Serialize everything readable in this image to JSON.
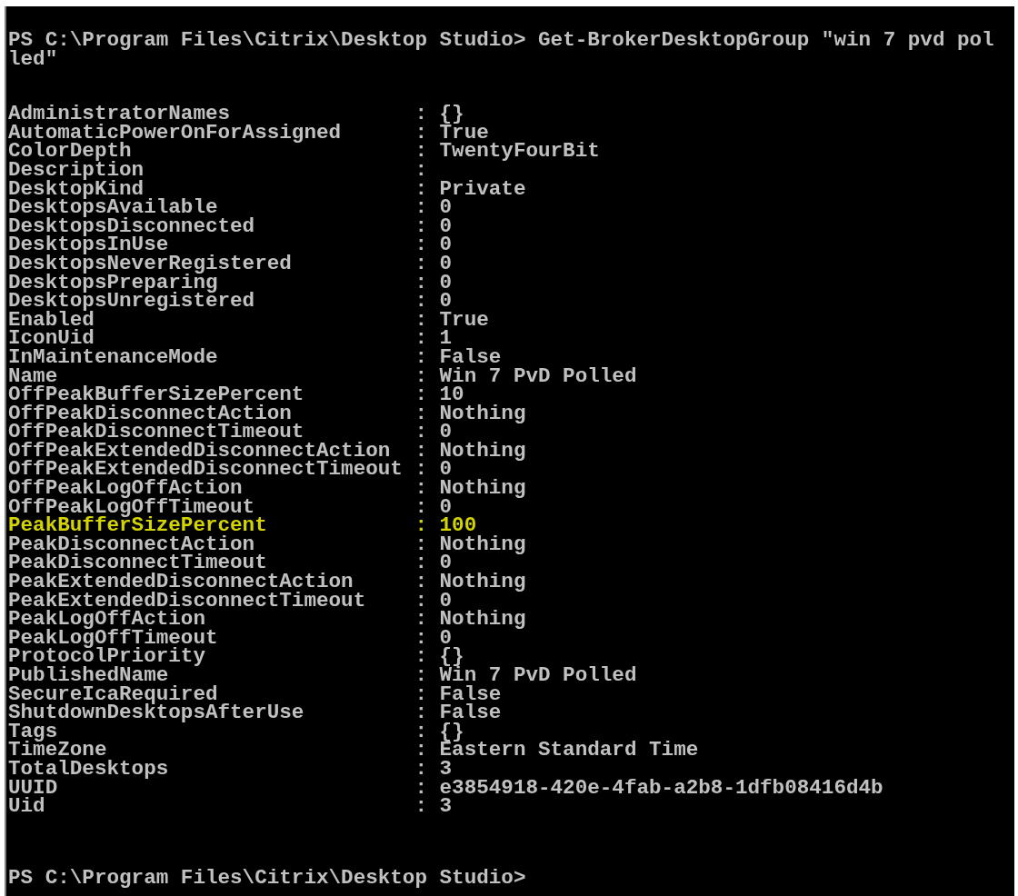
{
  "command_lines": [
    "PS C:\\Program Files\\Citrix\\Desktop Studio> Get-BrokerDesktopGroup \"win 7 pvd pol",
    "led\""
  ],
  "properties": [
    {
      "name": "AdministratorNames",
      "value": ": {}",
      "highlighted": false
    },
    {
      "name": "AutomaticPowerOnForAssigned",
      "value": ": True",
      "highlighted": false
    },
    {
      "name": "ColorDepth",
      "value": ": TwentyFourBit",
      "highlighted": false
    },
    {
      "name": "Description",
      "value": ":",
      "highlighted": false
    },
    {
      "name": "DesktopKind",
      "value": ": Private",
      "highlighted": false
    },
    {
      "name": "DesktopsAvailable",
      "value": ": 0",
      "highlighted": false
    },
    {
      "name": "DesktopsDisconnected",
      "value": ": 0",
      "highlighted": false
    },
    {
      "name": "DesktopsInUse",
      "value": ": 0",
      "highlighted": false
    },
    {
      "name": "DesktopsNeverRegistered",
      "value": ": 0",
      "highlighted": false
    },
    {
      "name": "DesktopsPreparing",
      "value": ": 0",
      "highlighted": false
    },
    {
      "name": "DesktopsUnregistered",
      "value": ": 0",
      "highlighted": false
    },
    {
      "name": "Enabled",
      "value": ": True",
      "highlighted": false
    },
    {
      "name": "IconUid",
      "value": ": 1",
      "highlighted": false
    },
    {
      "name": "InMaintenanceMode",
      "value": ": False",
      "highlighted": false
    },
    {
      "name": "Name",
      "value": ": Win 7 PvD Polled",
      "highlighted": false
    },
    {
      "name": "OffPeakBufferSizePercent",
      "value": ": 10",
      "highlighted": false
    },
    {
      "name": "OffPeakDisconnectAction",
      "value": ": Nothing",
      "highlighted": false
    },
    {
      "name": "OffPeakDisconnectTimeout",
      "value": ": 0",
      "highlighted": false
    },
    {
      "name": "OffPeakExtendedDisconnectAction",
      "value": ": Nothing",
      "highlighted": false
    },
    {
      "name": "OffPeakExtendedDisconnectTimeout",
      "value": ": 0",
      "highlighted": false
    },
    {
      "name": "OffPeakLogOffAction",
      "value": ": Nothing",
      "highlighted": false
    },
    {
      "name": "OffPeakLogOffTimeout",
      "value": ": 0",
      "highlighted": false
    },
    {
      "name": "PeakBufferSizePercent",
      "value": ": 100",
      "highlighted": true
    },
    {
      "name": "PeakDisconnectAction",
      "value": ": Nothing",
      "highlighted": false
    },
    {
      "name": "PeakDisconnectTimeout",
      "value": ": 0",
      "highlighted": false
    },
    {
      "name": "PeakExtendedDisconnectAction",
      "value": ": Nothing",
      "highlighted": false
    },
    {
      "name": "PeakExtendedDisconnectTimeout",
      "value": ": 0",
      "highlighted": false
    },
    {
      "name": "PeakLogOffAction",
      "value": ": Nothing",
      "highlighted": false
    },
    {
      "name": "PeakLogOffTimeout",
      "value": ": 0",
      "highlighted": false
    },
    {
      "name": "ProtocolPriority",
      "value": ": {}",
      "highlighted": false
    },
    {
      "name": "PublishedName",
      "value": ": Win 7 PvD Polled",
      "highlighted": false
    },
    {
      "name": "SecureIcaRequired",
      "value": ": False",
      "highlighted": false
    },
    {
      "name": "ShutdownDesktopsAfterUse",
      "value": ": False",
      "highlighted": false
    },
    {
      "name": "Tags",
      "value": ": {}",
      "highlighted": false
    },
    {
      "name": "TimeZone",
      "value": ": Eastern Standard Time",
      "highlighted": false
    },
    {
      "name": "TotalDesktops",
      "value": ": 3",
      "highlighted": false
    },
    {
      "name": "UUID",
      "value": ": e3854918-420e-4fab-a2b8-1dfb08416d4b",
      "highlighted": false
    },
    {
      "name": "Uid",
      "value": ": 3",
      "highlighted": false
    }
  ],
  "prompt": "PS C:\\Program Files\\Citrix\\Desktop Studio>"
}
